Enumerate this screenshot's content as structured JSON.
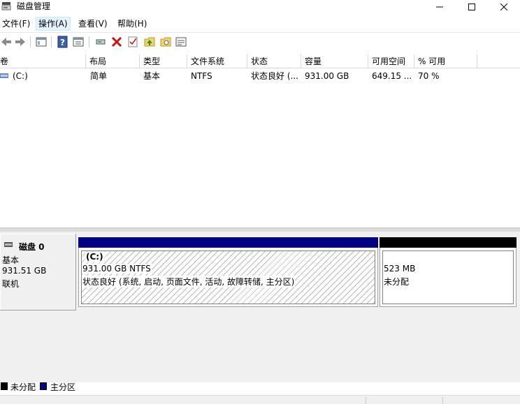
{
  "window": {
    "title": "磁盘管理",
    "icon": "disk-management-icon"
  },
  "menu": [
    {
      "label": "文件(F)",
      "active": false
    },
    {
      "label": "操作(A)",
      "active": true
    },
    {
      "label": "查看(V)",
      "active": false
    },
    {
      "label": "帮助(H)",
      "active": false
    }
  ],
  "toolbar_icons": [
    "back-arrow-icon",
    "forward-arrow-icon",
    "console-tree-icon",
    "help-icon",
    "properties-icon",
    "connect-drive-icon",
    "delete-x-icon",
    "check-icon",
    "folder-up-icon",
    "folder-search-icon",
    "details-view-icon"
  ],
  "volumes": {
    "columns": [
      "卷",
      "布局",
      "类型",
      "文件系统",
      "状态",
      "容量",
      "可用空间",
      "% 可用"
    ],
    "rows": [
      [
        "(C:)",
        "简单",
        "基本",
        "NTFS",
        "状态良好 (...",
        "931.00 GB",
        "649.15 ...",
        "70 %"
      ]
    ]
  },
  "disk": {
    "name": "磁盘 0",
    "type": "基本",
    "size": "931.51 GB",
    "status": "联机",
    "partitions": [
      {
        "title": "(C:)",
        "size": "931.00 GB NTFS",
        "status": "状态良好 (系统, 启动, 页面文件, 活动, 故障转储, 主分区)",
        "bar_color": "#000080"
      },
      {
        "size": "523 MB",
        "status": "未分配",
        "bar_color": "#000000"
      }
    ]
  },
  "legend": [
    {
      "label": "未分配",
      "color": "#000000"
    },
    {
      "label": "主分区",
      "color": "#000080"
    }
  ]
}
